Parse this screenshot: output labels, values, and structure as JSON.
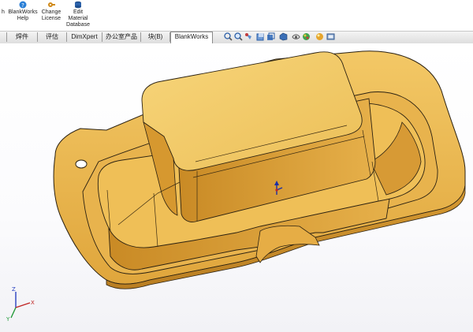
{
  "ribbon": {
    "partial_label": "h",
    "buttons": [
      {
        "label_1": "BlankWorks",
        "label_2": "Help",
        "label_3": "",
        "icon": "help-icon",
        "color": "#2a7fd6"
      },
      {
        "label_1": "Change",
        "label_2": "License",
        "label_3": "",
        "icon": "license-icon",
        "color": "#d08a1a"
      },
      {
        "label_1": "Edit",
        "label_2": "Material",
        "label_3": "Database",
        "icon": "database-icon",
        "color": "#1f4f8f"
      }
    ]
  },
  "tabs": [
    {
      "label": "",
      "active": false
    },
    {
      "label": "焊件",
      "active": false
    },
    {
      "label": "评估",
      "active": false
    },
    {
      "label": "DimXpert",
      "active": false
    },
    {
      "label": "办公室产品",
      "active": false
    },
    {
      "label": "块(B)",
      "active": false
    },
    {
      "label": "BlankWorks",
      "active": true
    }
  ],
  "heads_up_toolbar": [
    "zoom-to-fit-icon",
    "zoom-area-icon",
    "previous-view-icon",
    "section-view-icon",
    "view-orientation-icon",
    "display-style-icon",
    "hide-show-icon",
    "edit-appearance-icon",
    "scene-icon",
    "view-settings-icon"
  ],
  "model": {
    "part": "stamped-tray-part",
    "color": "#f1c25e",
    "edge_color": "#2b2111"
  },
  "triad": {
    "x": "X",
    "y": "Y",
    "z": "Z"
  }
}
